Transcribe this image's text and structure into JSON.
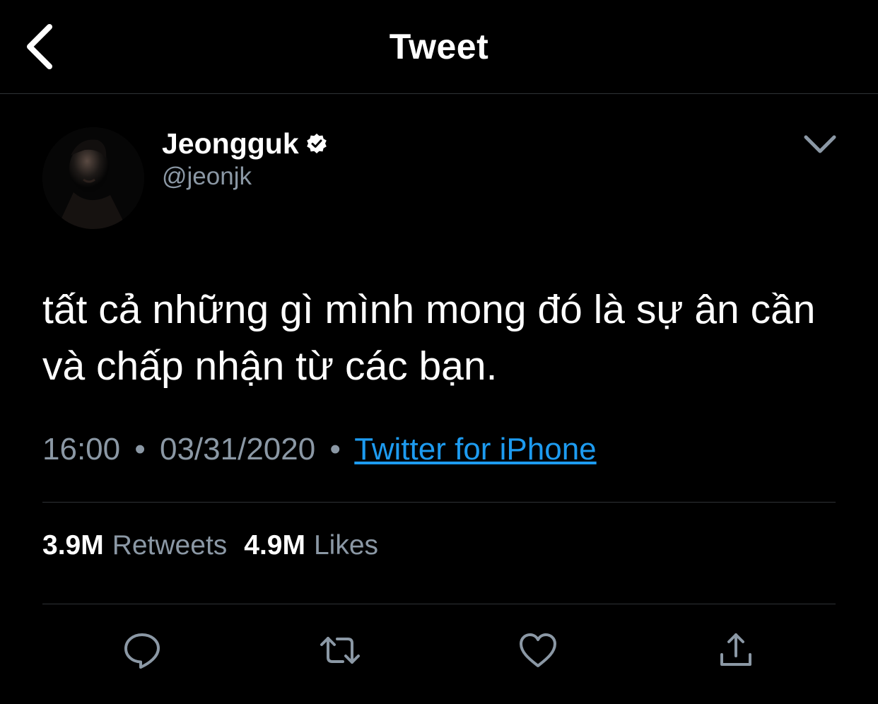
{
  "header": {
    "title": "Tweet",
    "back_icon": "chevron-left-icon"
  },
  "tweet": {
    "author": {
      "display_name": "Jeongguk",
      "handle": "@jeonjk",
      "verified_icon": "verified-badge-icon"
    },
    "text": "tất cả những gì mình mong đó là sự ân cần và chấp nhận từ các bạn.",
    "time": "16:00",
    "date": "03/31/2020",
    "separator": "•",
    "source": "Twitter for iPhone",
    "stats": {
      "retweets_count": "3.9M",
      "retweets_label": "Retweets",
      "likes_count": "4.9M",
      "likes_label": "Likes"
    },
    "actions": [
      "reply-icon",
      "retweet-icon",
      "like-icon",
      "share-icon"
    ]
  },
  "colors": {
    "background": "#000000",
    "text": "#ffffff",
    "secondary": "#8b98a5",
    "link": "#1d9bf0",
    "divider": "#2f3336"
  }
}
